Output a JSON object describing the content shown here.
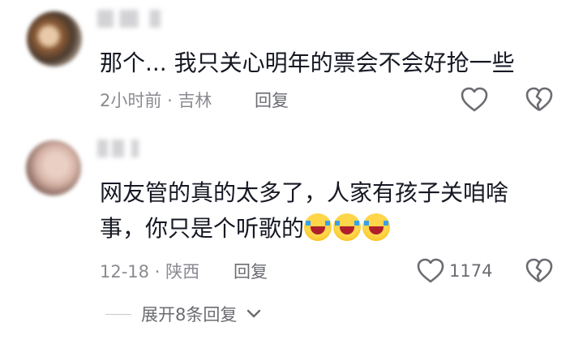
{
  "comments": [
    {
      "text": "那个... 我只关心明年的票会不会好抢一些",
      "time": "2小时前",
      "sep": "·",
      "location": "吉林",
      "reply_label": "回复",
      "likes": ""
    },
    {
      "text_line1": "网友管的真的太多了，人家有孩子关咱啥",
      "text_line2": "事，你只是个听歌的",
      "time": "12-18",
      "sep": "·",
      "location": "陕西",
      "reply_label": "回复",
      "likes": "1174"
    }
  ],
  "expand_label": "展开8条回复",
  "icons": [
    "heart-outline-icon",
    "broken-heart-icon",
    "chevron-down-icon"
  ],
  "colors": {
    "text": "#161823",
    "meta": "#8a8b91",
    "icon": "#6b6c72"
  }
}
